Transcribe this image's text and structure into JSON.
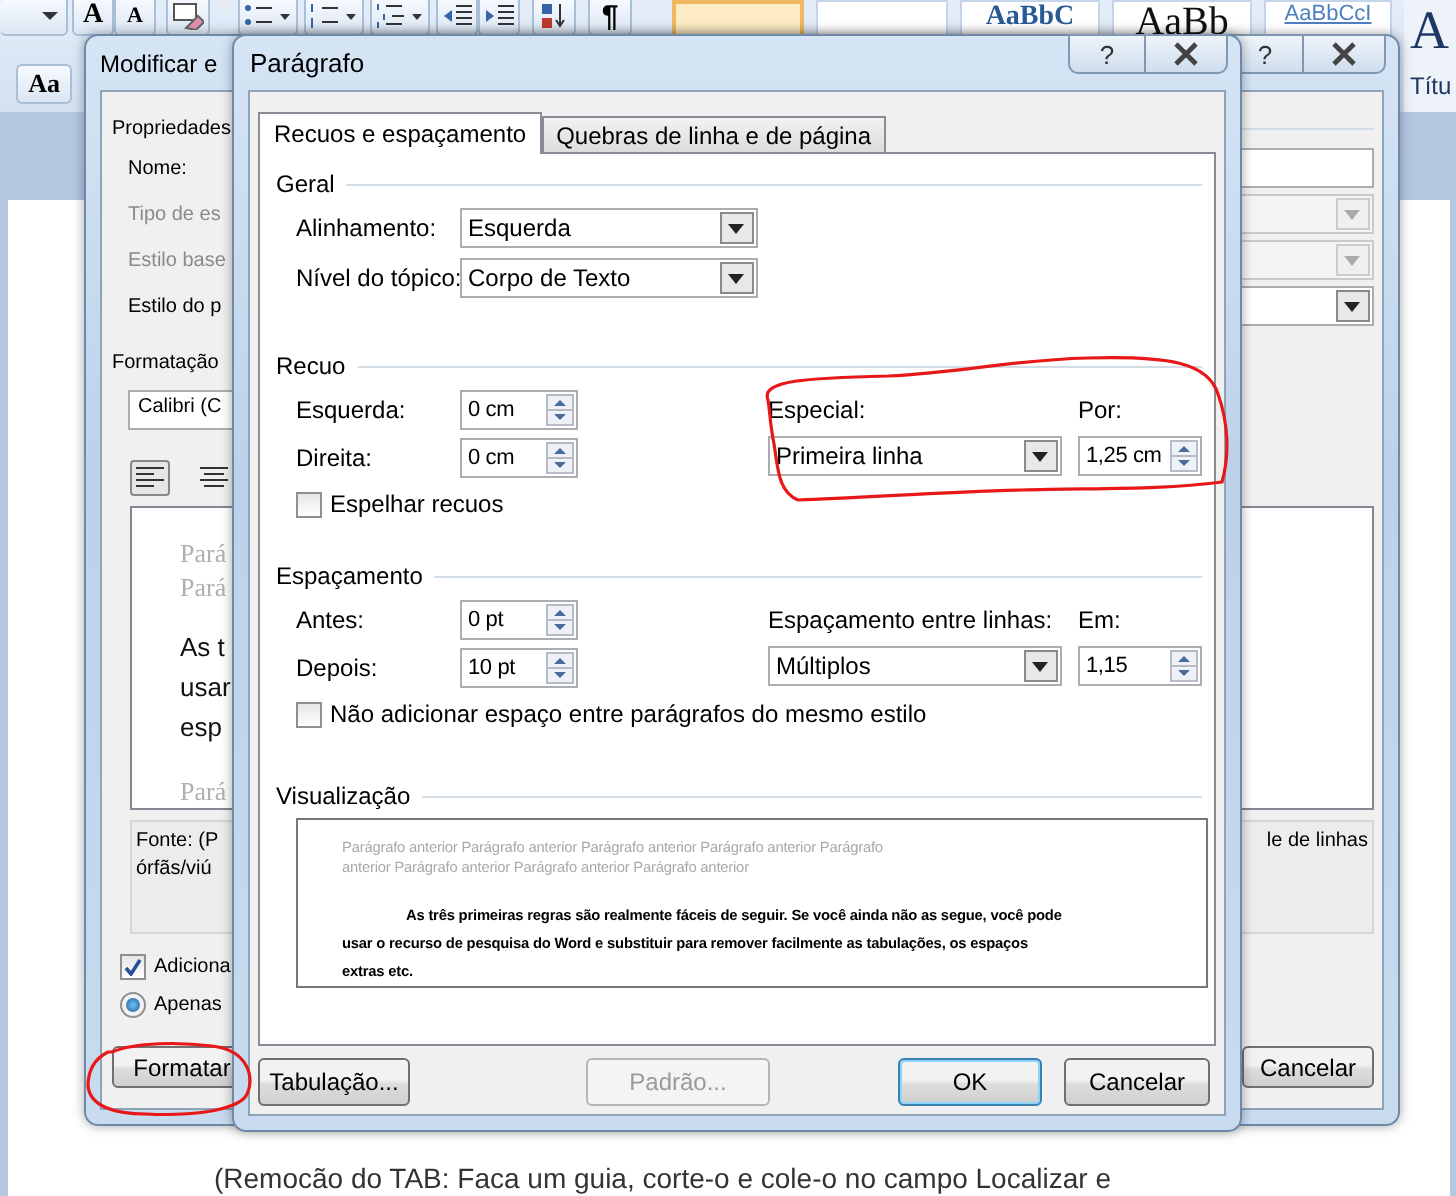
{
  "ribbon": {
    "tools": [
      {
        "kind": "combo"
      },
      {
        "kind": "grow",
        "label": "A"
      },
      {
        "kind": "shrink",
        "label": "A"
      },
      {
        "kind": "clear"
      },
      {
        "kind": "bullets"
      },
      {
        "kind": "numbering"
      },
      {
        "kind": "multilevel"
      },
      {
        "kind": "outdent"
      },
      {
        "kind": "indent"
      },
      {
        "kind": "sort"
      },
      {
        "kind": "pilcrow",
        "label": "¶"
      }
    ],
    "case_button": "Aa",
    "styles": [
      {
        "sample": "AaBbC",
        "kind": "heading1"
      },
      {
        "sample": "AaBb",
        "kind": "title"
      },
      {
        "sample": "AaBbCcI",
        "kind": "subtle"
      },
      {
        "sample": "A",
        "kind": "big",
        "name": "Títu"
      }
    ]
  },
  "document": {
    "text": "(Remocão do TAB: Faca um guia, corte-o e cole-o no campo Localizar  e"
  },
  "style_dialog": {
    "title": "Modificar e",
    "help_button": "?",
    "properties": {
      "heading": "Propriedades",
      "fields": [
        {
          "label": "Nome:",
          "kind": "text",
          "disabled": false
        },
        {
          "label": "Tipo de es",
          "kind": "select",
          "disabled": true
        },
        {
          "label": "Estilo base",
          "kind": "select",
          "disabled": true
        },
        {
          "label": "Estilo do p",
          "kind": "select",
          "disabled": false
        }
      ]
    },
    "formatting": {
      "heading": "Formatação",
      "font": "Calibri (C",
      "align": [
        {
          "selected": true
        },
        {
          "selected": false
        }
      ],
      "preview": [
        {
          "kind": "previous",
          "text": "Pará"
        },
        {
          "kind": "previous",
          "text": "Pará"
        },
        {
          "kind": "current",
          "text": "As t"
        },
        {
          "kind": "current",
          "text": "usar"
        },
        {
          "kind": "current",
          "text": "esp"
        },
        {
          "kind": "next",
          "text": "Pará"
        }
      ],
      "description": [
        "Fonte: (P",
        "órfãs/viú"
      ],
      "description_tail": "le de linhas"
    },
    "add_to_gallery": {
      "label": "Adiciona",
      "checked": true
    },
    "scope": {
      "label": "Apenas",
      "selected": true
    },
    "format_button": "Formatar",
    "cancel_button": "Cancelar"
  },
  "paragraph_dialog": {
    "title": "Parágrafo",
    "help_button": "?",
    "tabs": [
      {
        "label": "Recuos e espaçamento",
        "selected": true
      },
      {
        "label": "Quebras de linha e de página",
        "selected": false
      }
    ],
    "general": {
      "heading": "Geral",
      "alignment": {
        "label": "Alinhamento:",
        "value": "Esquerda"
      },
      "outline_level": {
        "label": "Nível do tópico:",
        "value": "Corpo de Texto"
      }
    },
    "indent": {
      "heading": "Recuo",
      "left": {
        "label": "Esquerda:",
        "value": "0 cm"
      },
      "right": {
        "label": "Direita:",
        "value": "0 cm"
      },
      "special": {
        "label": "Especial:",
        "value": "Primeira linha"
      },
      "by": {
        "label": "Por:",
        "value": "1,25 cm"
      },
      "mirror": {
        "label": "Espelhar recuos",
        "checked": false
      }
    },
    "spacing": {
      "heading": "Espaçamento",
      "before": {
        "label": "Antes:",
        "value": "0 pt"
      },
      "after": {
        "label": "Depois:",
        "value": "10 pt"
      },
      "line_spacing": {
        "label": "Espaçamento entre linhas:",
        "value": "Múltiplos"
      },
      "at": {
        "label": "Em:",
        "value": "1,15"
      },
      "no_space": {
        "label": "Não adicionar espaço entre parágrafos do mesmo estilo",
        "checked": false
      }
    },
    "preview": {
      "heading": "Visualização",
      "previous": [
        "Parágrafo anterior Parágrafo anterior Parágrafo anterior Parágrafo anterior Parágrafo",
        "anterior Parágrafo anterior Parágrafo anterior Parágrafo anterior"
      ],
      "current": [
        "As três primeiras regras são realmente fáceis de seguir. Se você ainda não as segue, você pode",
        "usar o recurso de pesquisa do Word e substituir para remover facilmente as tabulações, os espaços",
        "extras etc."
      ]
    },
    "buttons": [
      {
        "label": "Tabulação...",
        "kind": "normal"
      },
      {
        "label": "Padrão...",
        "kind": "disabled"
      },
      {
        "label": "OK",
        "kind": "default"
      },
      {
        "label": "Cancelar",
        "kind": "normal"
      }
    ]
  }
}
